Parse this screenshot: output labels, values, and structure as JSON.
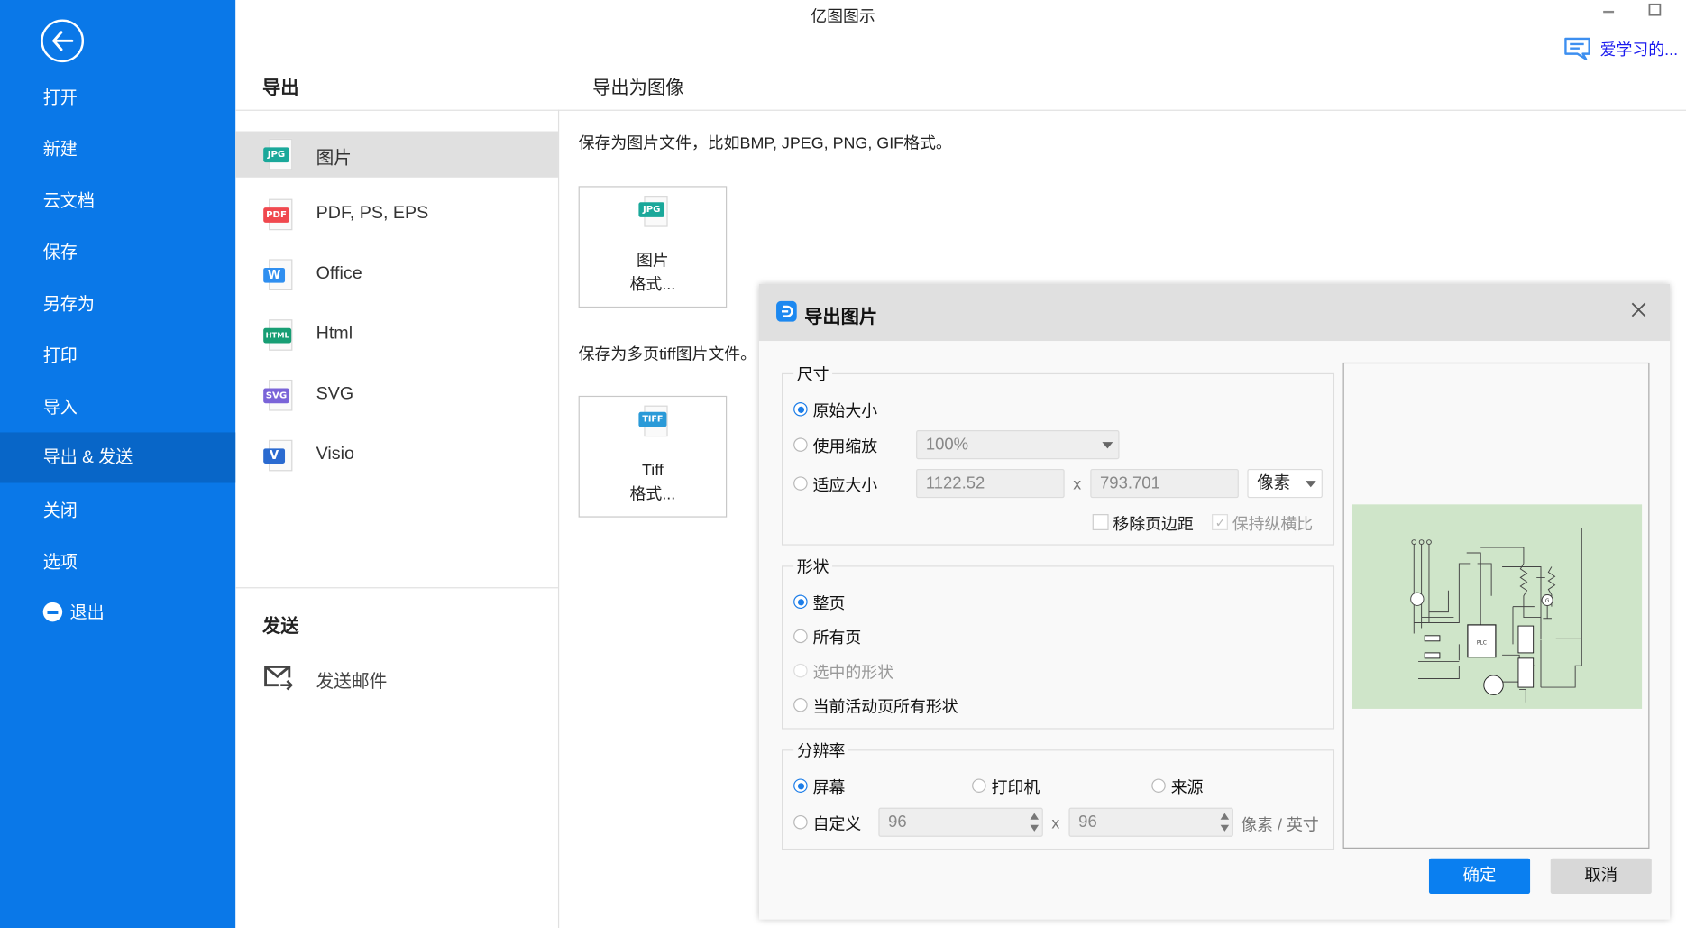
{
  "window": {
    "title": "亿图图示",
    "minimize_icon": "minimize-icon",
    "maximize_icon": "maximize-icon",
    "user_name": "爱学习的...",
    "user_icon": "chat-bubble-icon"
  },
  "sidebar": {
    "back_icon": "arrow-left-circle-icon",
    "items": [
      {
        "label": "打开"
      },
      {
        "label": "新建"
      },
      {
        "label": "云文档"
      },
      {
        "label": "保存"
      },
      {
        "label": "另存为"
      },
      {
        "label": "打印"
      },
      {
        "label": "导入"
      },
      {
        "label": "导出 & 发送",
        "active": true
      },
      {
        "label": "关闭"
      },
      {
        "label": "选项"
      },
      {
        "label": "退出",
        "icon": "exit-icon"
      }
    ]
  },
  "export_panel": {
    "heading": "导出",
    "formats": [
      {
        "label": "图片",
        "badge": "JPG",
        "color": "#1aa89a",
        "active": true
      },
      {
        "label": "PDF, PS, EPS",
        "badge": "PDF",
        "color": "#f0484e"
      },
      {
        "label": "Office",
        "badge": "W",
        "color": "#2f8ff0"
      },
      {
        "label": "Html",
        "badge": "HTML",
        "color": "#179e74"
      },
      {
        "label": "SVG",
        "badge": "SVG",
        "color": "#7a64d8"
      },
      {
        "label": "Visio",
        "badge": "V",
        "color": "#2a6ad0"
      }
    ],
    "send_heading": "发送",
    "send_items": [
      {
        "label": "发送邮件",
        "icon": "mail-send-icon"
      }
    ]
  },
  "content": {
    "heading": "导出为图像",
    "image_desc": "保存为图片文件，比如BMP, JPEG, PNG, GIF格式。",
    "image_tile": {
      "line1": "图片",
      "line2": "格式...",
      "badge": "JPG"
    },
    "tiff_desc": "保存为多页tiff图片文件。",
    "tiff_tile": {
      "line1": "Tiff",
      "line2": "格式...",
      "badge": "TIFF"
    }
  },
  "dialog": {
    "title": "导出图片",
    "close_icon": "close-icon",
    "size_group": {
      "legend": "尺寸",
      "original_size": "原始大小",
      "use_zoom": "使用缩放",
      "zoom_value": "100%",
      "fit_size": "适应大小",
      "width_value": "1122.52",
      "x_label": "x",
      "height_value": "793.701",
      "unit_value": "像素",
      "remove_margin": "移除页边距",
      "keep_ratio": "保持纵横比",
      "selected": "原始大小"
    },
    "shape_group": {
      "legend": "形状",
      "options": [
        "整页",
        "所有页",
        "选中的形状",
        "当前活动页所有形状"
      ],
      "selected": "整页",
      "disabled": [
        "选中的形状"
      ]
    },
    "resolution_group": {
      "legend": "分辨率",
      "screen": "屏幕",
      "printer": "打印机",
      "source": "来源",
      "custom": "自定义",
      "dpi_x": "96",
      "x_label": "x",
      "dpi_y": "96",
      "unit": "像素 / 英寸",
      "selected": "屏幕"
    },
    "preview": {
      "label_plc": "PLC",
      "label_g": "G"
    },
    "ok_label": "确定",
    "cancel_label": "取消"
  }
}
